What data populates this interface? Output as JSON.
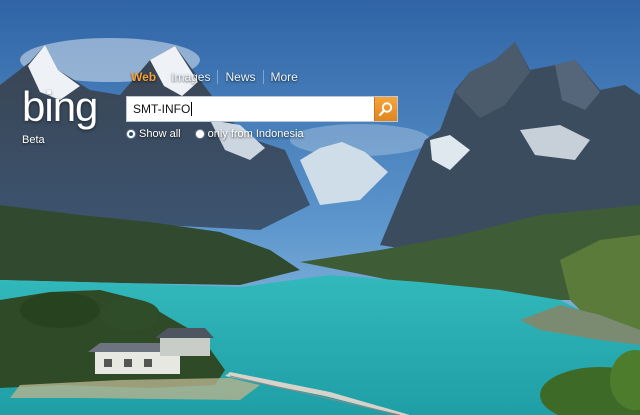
{
  "brand": {
    "logo_text": "bing",
    "beta_label": "Beta"
  },
  "tabs": [
    {
      "label": "Web",
      "active": true
    },
    {
      "label": "Images",
      "active": false
    },
    {
      "label": "News",
      "active": false
    },
    {
      "label": "More",
      "active": false
    }
  ],
  "search": {
    "value": "SMT-INFO",
    "placeholder": ""
  },
  "scope_options": [
    {
      "label": "Show all",
      "checked": true
    },
    {
      "label": "only from Indonesia",
      "checked": false
    }
  ],
  "icons": {
    "search": "magnifier-icon"
  },
  "colors": {
    "accent": "#f5a13a",
    "lake": "#2bb7b5",
    "sky": "#3f7fbf"
  }
}
